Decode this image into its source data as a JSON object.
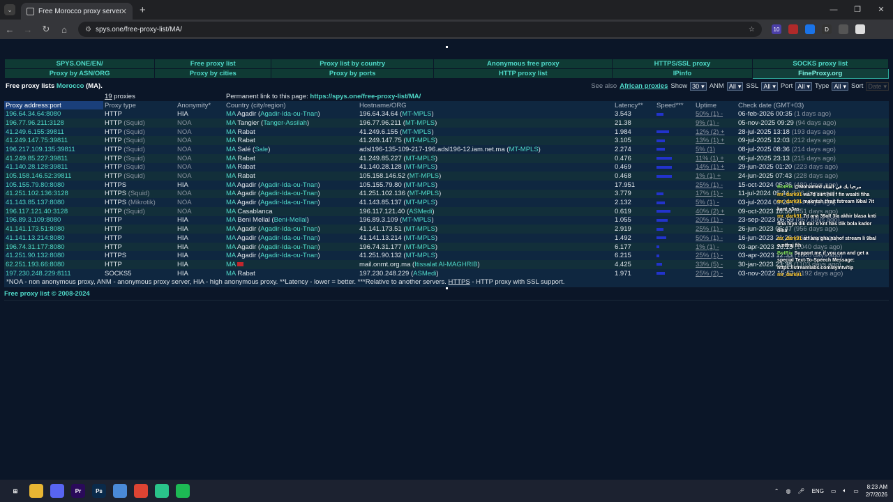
{
  "browser": {
    "tab_title": "Free Morocco proxy servers.",
    "url": "spys.one/free-proxy-list/MA/",
    "extensions": [
      {
        "name": "ext-badge-icon",
        "label": "10",
        "color": "#4b3fa8"
      },
      {
        "name": "ext-red-icon",
        "label": "",
        "color": "#b02a2a"
      },
      {
        "name": "ext-blue-icon",
        "label": "",
        "color": "#1a73e8"
      },
      {
        "name": "ext-d-icon",
        "label": "D",
        "color": "#333"
      },
      {
        "name": "puzzle-icon",
        "label": "",
        "color": "#555"
      },
      {
        "name": "avatar-icon",
        "label": "",
        "color": "#ddd"
      }
    ]
  },
  "nav": {
    "row1": [
      "SPYS.ONE/EN/",
      "Free proxy list",
      "Proxy list by country",
      "Anonymous free proxy",
      "HTTPS/SSL proxy",
      "SOCKS proxy list"
    ],
    "row2": [
      "Proxy by ASN/ORG",
      "Proxy by cities",
      "Proxy by ports",
      "HTTP proxy list",
      "IPinfo",
      "FineProxy.org"
    ]
  },
  "filters": {
    "title_prefix": "Free proxy lists ",
    "title_country": "Morocco",
    "title_suffix": " (MA).",
    "see_also": "See also",
    "see_also_link": "African proxies",
    "show_label": "Show",
    "show_value": "30",
    "anm_label": "ANM",
    "anm_value": "All",
    "ssl_label": "SSL",
    "ssl_value": "All",
    "port_label": "Port",
    "port_value": "All",
    "type_label": "Type",
    "type_value": "All",
    "sort_label": "Sort",
    "sort_value": "Date"
  },
  "info": {
    "count": "19",
    "count_label": " proxies",
    "perm_label": "Permanent link to this page: ",
    "perm_link": "https://spys.one/free-proxy-list/MA/"
  },
  "headers": {
    "ip": "Proxy address:port",
    "type": "Proxy type",
    "anon": "Anonymity*",
    "country": "Country (city/region)",
    "host": "Hostname/ORG",
    "latency": "Latency**",
    "speed": "Speed***",
    "uptime": "Uptime",
    "date": "Check date (GMT+03)"
  },
  "rows": [
    {
      "ip": "196.64.34.64:8080",
      "type": "HTTP",
      "type_sub": "",
      "anon": "HIA",
      "cc": "MA",
      "city": "Agadir",
      "region": "Agadir-Ida-ou-Tnan",
      "host": "196.64.34.64",
      "org": "MT-MPLS",
      "latency": "3.543",
      "speed": 0.25,
      "uptime": "50% (1) -",
      "date": "06-feb-2026 00:35",
      "ago": "(1 days ago)"
    },
    {
      "ip": "196.77.96.211:3128",
      "type": "HTTP",
      "type_sub": "(Squid)",
      "anon": "NOA",
      "cc": "MA",
      "city": "Tangier",
      "region": "Tanger-Assilah",
      "host": "196.77.96.211",
      "org": "MT-MPLS",
      "latency": "21.38",
      "speed": 0.0,
      "uptime": "9% (1) -",
      "date": "05-nov-2025 09:29",
      "ago": "(94 days ago)"
    },
    {
      "ip": "41.249.6.155:39811",
      "type": "HTTP",
      "type_sub": "(Squid)",
      "anon": "NOA",
      "cc": "MA",
      "city": "Rabat",
      "region": "",
      "host": "41.249.6.155",
      "org": "MT-MPLS",
      "latency": "1.984",
      "speed": 0.45,
      "uptime": "12% (2) +",
      "date": "28-jul-2025 13:18",
      "ago": "(193 days ago)"
    },
    {
      "ip": "41.249.147.75:39811",
      "type": "HTTP",
      "type_sub": "(Squid)",
      "anon": "NOA",
      "cc": "MA",
      "city": "Rabat",
      "region": "",
      "host": "41.249.147.75",
      "org": "MT-MPLS",
      "latency": "3.105",
      "speed": 0.3,
      "uptime": "13% (1) +",
      "date": "09-jul-2025 12:03",
      "ago": "(212 days ago)"
    },
    {
      "ip": "196.217.109.135:39811",
      "type": "HTTP",
      "type_sub": "(Squid)",
      "anon": "NOA",
      "cc": "MA",
      "city": "Salé",
      "region": "Sale",
      "host": "adsl196-135-109-217-196.adsl196-12.iam.net.ma",
      "org": "MT-MPLS",
      "latency": "2.274",
      "speed": 0.3,
      "uptime": "5% (1)",
      "date": "08-jul-2025 08:36",
      "ago": "(214 days ago)"
    },
    {
      "ip": "41.249.85.227:39811",
      "type": "HTTP",
      "type_sub": "(Squid)",
      "anon": "NOA",
      "cc": "MA",
      "city": "Rabat",
      "region": "",
      "host": "41.249.85.227",
      "org": "MT-MPLS",
      "latency": "0.476",
      "speed": 0.55,
      "uptime": "11% (1) +",
      "date": "06-jul-2025 23:13",
      "ago": "(215 days ago)"
    },
    {
      "ip": "41.140.28.128:39811",
      "type": "HTTP",
      "type_sub": "(Squid)",
      "anon": "NOA",
      "cc": "MA",
      "city": "Rabat",
      "region": "",
      "host": "41.140.28.128",
      "org": "MT-MPLS",
      "latency": "0.469",
      "speed": 0.55,
      "uptime": "14% (1) +",
      "date": "29-jun-2025 01:20",
      "ago": "(223 days ago)"
    },
    {
      "ip": "105.158.146.52:39811",
      "type": "HTTP",
      "type_sub": "(Squid)",
      "anon": "NOA",
      "cc": "MA",
      "city": "Rabat",
      "region": "",
      "host": "105.158.146.52",
      "org": "MT-MPLS",
      "latency": "0.468",
      "speed": 0.55,
      "uptime": "1% (1) +",
      "date": "24-jun-2025 07:43",
      "ago": "(228 days ago)"
    },
    {
      "ip": "105.155.79.80:8080",
      "type": "HTTPS",
      "type_sub": "",
      "anon": "HIA",
      "cc": "MA",
      "city": "Agadir",
      "region": "Agadir-Ida-ou-Tnan",
      "host": "105.155.79.80",
      "org": "MT-MPLS",
      "latency": "17.951",
      "speed": 0.0,
      "uptime": "25% (1) -",
      "date": "15-oct-2024 05:36",
      "ago": "(480 days ago)"
    },
    {
      "ip": "41.251.102.136:3128",
      "type": "HTTPS",
      "type_sub": "(Squid)",
      "anon": "NOA",
      "cc": "MA",
      "city": "Agadir",
      "region": "Agadir-Ida-ou-Tnan",
      "host": "41.251.102.136",
      "org": "MT-MPLS",
      "latency": "3.779",
      "speed": 0.25,
      "uptime": "17% (1) -",
      "date": "11-jul-2024 05:34",
      "ago": "(576 days ago)"
    },
    {
      "ip": "41.143.85.137:8080",
      "type": "HTTPS",
      "type_sub": "(Mikrotik)",
      "anon": "NOA",
      "cc": "MA",
      "city": "Agadir",
      "region": "Agadir-Ida-ou-Tnan",
      "host": "41.143.85.137",
      "org": "MT-MPLS",
      "latency": "2.132",
      "speed": 0.3,
      "uptime": "5% (1) -",
      "date": "03-jul-2024 09:26",
      "ago": "(584 days ago)"
    },
    {
      "ip": "196.117.121.40:3128",
      "type": "HTTP",
      "type_sub": "(Squid)",
      "anon": "NOA",
      "cc": "MA",
      "city": "Casablanca",
      "region": "",
      "host": "196.117.121.40",
      "org": "ASMedi",
      "latency": "0.619",
      "speed": 0.5,
      "uptime": "40% (2) +",
      "date": "09-oct-2023 18:50",
      "ago": "(851 days ago)"
    },
    {
      "ip": "196.89.3.109:8080",
      "type": "HTTP",
      "type_sub": "",
      "anon": "HIA",
      "cc": "MA",
      "city": "Beni Mellal",
      "region": "Beni-Mellal",
      "host": "196.89.3.109",
      "org": "MT-MPLS",
      "latency": "1.055",
      "speed": 0.4,
      "uptime": "20% (1) -",
      "date": "23-sep-2023 06:59",
      "ago": "(867 days ago)"
    },
    {
      "ip": "41.141.173.51:8080",
      "type": "HTTP",
      "type_sub": "",
      "anon": "HIA",
      "cc": "MA",
      "city": "Agadir",
      "region": "Agadir-Ida-ou-Tnan",
      "host": "41.141.173.51",
      "org": "MT-MPLS",
      "latency": "2.919",
      "speed": 0.25,
      "uptime": "25% (1) -",
      "date": "26-jun-2023 06:47",
      "ago": "(956 days ago)"
    },
    {
      "ip": "41.141.13.214:8080",
      "type": "HTTP",
      "type_sub": "",
      "anon": "HIA",
      "cc": "MA",
      "city": "Agadir",
      "region": "Agadir-Ida-ou-Tnan",
      "host": "41.141.13.214",
      "org": "MT-MPLS",
      "latency": "1.492",
      "speed": 0.35,
      "uptime": "50% (1) -",
      "date": "16-jun-2023 21:29",
      "ago": "(966 days ago)"
    },
    {
      "ip": "196.74.31.177:8080",
      "type": "HTTP",
      "type_sub": "",
      "anon": "HIA",
      "cc": "MA",
      "city": "Agadir",
      "region": "Agadir-Ida-ou-Tnan",
      "host": "196.74.31.177",
      "org": "MT-MPLS",
      "latency": "6.177",
      "speed": 0.1,
      "uptime": "1% (1) -",
      "date": "03-apr-2023 16:13",
      "ago": "(1040 days ago)"
    },
    {
      "ip": "41.251.90.132:8080",
      "type": "HTTPS",
      "type_sub": "",
      "anon": "HIA",
      "cc": "MA",
      "city": "Agadir",
      "region": "Agadir-Ida-ou-Tnan",
      "host": "41.251.90.132",
      "org": "MT-MPLS",
      "latency": "6.215",
      "speed": 0.1,
      "uptime": "25% (1) -",
      "date": "03-apr-2023 12:33",
      "ago": "(1040 days ago)"
    },
    {
      "ip": "62.251.193.66:8080",
      "type": "HTTP",
      "type_sub": "",
      "anon": "HIA",
      "cc": "MA",
      "city": "",
      "region": "",
      "host": "mail.onmt.org.ma",
      "org": "Itissalat Al-MAGHRIB",
      "latency": "4.425",
      "speed": 0.2,
      "uptime": "33% (5) -",
      "date": "30-jan-2023 23:38",
      "ago": "(1103 days ago)"
    },
    {
      "ip": "197.230.248.229:8111",
      "type": "SOCKS5",
      "type_sub": "",
      "anon": "HIA",
      "cc": "MA",
      "city": "Rabat",
      "region": "",
      "host": "197.230.248.229",
      "org": "ASMedi",
      "latency": "1.971",
      "speed": 0.3,
      "uptime": "25% (2) -",
      "date": "03-nov-2022 15:52",
      "ago": "(1192 days ago)"
    }
  ],
  "note": "*NOA - non anonymous proxy, ANM - anonymous proxy server, HIA - high anonymous proxy. **Latency - lower = better. ***Relative to another servers. ",
  "note_https": "HTTPS",
  "note_tail": " - HTTP proxy with SSL support.",
  "footer": "Free proxy list © 2008-2024",
  "chat": [
    {
      "user": "BotRix",
      "text": "@Mohamed مرحبا بك في القناة"
    },
    {
      "user": "mr_dark91",
      "text": "wa7d siirt hill f fin wsalti fiha"
    },
    {
      "user": "mr_dark91",
      "text": "makntsh tfrajt fstream l9bal 7it kant s3as"
    },
    {
      "user": "mr_dark91",
      "text": "7it ana 39alt 3la akhir blasa knti fiha hiya dik dar o knt has dik bola kador biha"
    },
    {
      "user": "mr_dark91",
      "text": "atf ana gha nshof stream li 9bal o ntfraj fih"
    },
    {
      "user": "BotRix",
      "text": "Support me if you can and get a special Text-To-Speech Message: https://streamlabs.com/aymtv/tip"
    },
    {
      "user": "mr_dark91",
      "text": ""
    }
  ],
  "taskbar": {
    "apps": [
      {
        "name": "start-icon",
        "label": "⊞",
        "color": "#1c2230"
      },
      {
        "name": "file-explorer-icon",
        "label": "",
        "color": "#e8b633"
      },
      {
        "name": "discord-icon",
        "label": "",
        "color": "#5865f2"
      },
      {
        "name": "premiere-icon",
        "label": "Pr",
        "color": "#2a0a5a"
      },
      {
        "name": "photoshop-icon",
        "label": "Ps",
        "color": "#0a2a4a"
      },
      {
        "name": "notepad-icon",
        "label": "",
        "color": "#4a8ad8"
      },
      {
        "name": "chrome-icon",
        "label": "",
        "color": "#dd4433"
      },
      {
        "name": "chat-app-icon",
        "label": "",
        "color": "#2ac48a"
      },
      {
        "name": "spotify-icon",
        "label": "",
        "color": "#1db954"
      }
    ],
    "lang": "ENG",
    "time": "8:23 AM",
    "date": "2/7/2026"
  }
}
